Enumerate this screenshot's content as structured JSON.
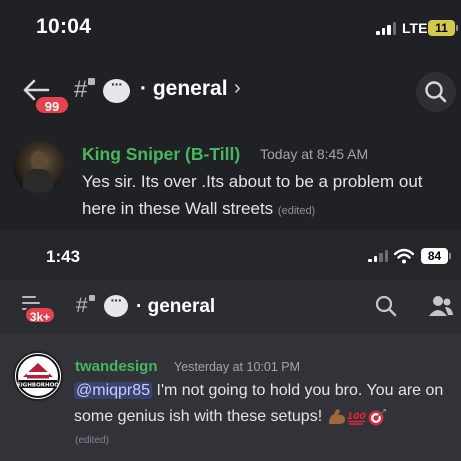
{
  "top_screenshot": {
    "status_bar": {
      "time": "10:04",
      "network": "LTE",
      "battery": "11"
    },
    "header": {
      "unread_badge": "99",
      "hash": "#",
      "channel": "· general",
      "chevron": "›"
    },
    "message": {
      "author": "King Sniper (B-Till)",
      "timestamp": "Today at 8:45 AM",
      "text": "Yes sir. Its over .Its about to be a problem out here in these Wall streets",
      "edited": "(edited)"
    }
  },
  "bottom_screenshot": {
    "status_bar": {
      "time": "1:43",
      "battery": "84"
    },
    "header": {
      "unread_badge": "3k+",
      "hash": "#",
      "channel": "· general"
    },
    "message": {
      "author": "twandesign",
      "timestamp": "Yesterday at 10:01 PM",
      "mention": "@miqpr85",
      "text": " I'm not going to hold you bro. You are on some genius ish with these setups! ",
      "emojis": [
        "flexed-biceps",
        "hundred-points",
        "direct-hit"
      ],
      "edited": "(edited)"
    },
    "avatar_logo_text": "EIGHBORHOO"
  },
  "colors": {
    "author_green": "#45b85d",
    "badge_red": "#e6414d",
    "mention_bg": "#3c4270",
    "battery_low": "#d4c94a"
  }
}
